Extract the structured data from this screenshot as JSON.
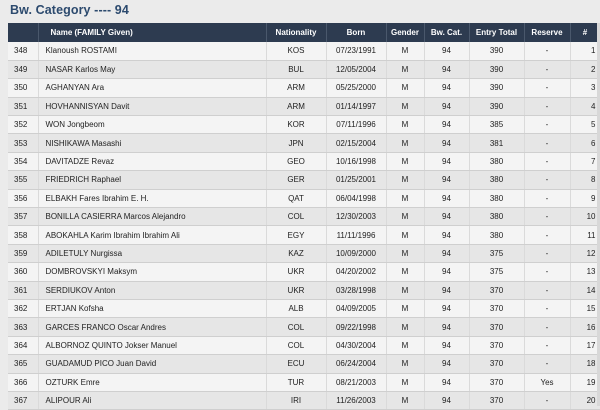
{
  "page": {
    "title": "Bw. Category ---- 94"
  },
  "table": {
    "headers": {
      "num": "",
      "name": "Name (FAMILY Given)",
      "nationality": "Nationality",
      "born": "Born",
      "gender": "Gender",
      "bwcat": "Bw. Cat.",
      "entry": "Entry Total",
      "reserve": "Reserve",
      "rank": "#"
    },
    "rows": [
      {
        "num": "348",
        "name": "Klanoush ROSTAMI",
        "nat": "KOS",
        "born": "07/23/1991",
        "gender": "M",
        "bw": "94",
        "entry": "390",
        "reserve": "-",
        "rank": "1"
      },
      {
        "num": "349",
        "name": "NASAR Karlos May",
        "nat": "BUL",
        "born": "12/05/2004",
        "gender": "M",
        "bw": "94",
        "entry": "390",
        "reserve": "-",
        "rank": "2"
      },
      {
        "num": "350",
        "name": "AGHANYAN Ara",
        "nat": "ARM",
        "born": "05/25/2000",
        "gender": "M",
        "bw": "94",
        "entry": "390",
        "reserve": "-",
        "rank": "3"
      },
      {
        "num": "351",
        "name": "HOVHANNISYAN Davit",
        "nat": "ARM",
        "born": "01/14/1997",
        "gender": "M",
        "bw": "94",
        "entry": "390",
        "reserve": "-",
        "rank": "4"
      },
      {
        "num": "352",
        "name": "WON Jongbeom",
        "nat": "KOR",
        "born": "07/11/1996",
        "gender": "M",
        "bw": "94",
        "entry": "385",
        "reserve": "-",
        "rank": "5"
      },
      {
        "num": "353",
        "name": "NISHIKAWA Masashi",
        "nat": "JPN",
        "born": "02/15/2004",
        "gender": "M",
        "bw": "94",
        "entry": "381",
        "reserve": "-",
        "rank": "6"
      },
      {
        "num": "354",
        "name": "DAVITADZE Revaz",
        "nat": "GEO",
        "born": "10/16/1998",
        "gender": "M",
        "bw": "94",
        "entry": "380",
        "reserve": "-",
        "rank": "7"
      },
      {
        "num": "355",
        "name": "FRIEDRICH Raphael",
        "nat": "GER",
        "born": "01/25/2001",
        "gender": "M",
        "bw": "94",
        "entry": "380",
        "reserve": "-",
        "rank": "8"
      },
      {
        "num": "356",
        "name": "ELBAKH Fares Ibrahim E. H.",
        "nat": "QAT",
        "born": "06/04/1998",
        "gender": "M",
        "bw": "94",
        "entry": "380",
        "reserve": "-",
        "rank": "9"
      },
      {
        "num": "357",
        "name": "BONILLA CASIERRA Marcos Alejandro",
        "nat": "COL",
        "born": "12/30/2003",
        "gender": "M",
        "bw": "94",
        "entry": "380",
        "reserve": "-",
        "rank": "10"
      },
      {
        "num": "358",
        "name": "ABOKAHLA Karim Ibrahim Ibrahim Ali",
        "nat": "EGY",
        "born": "11/11/1996",
        "gender": "M",
        "bw": "94",
        "entry": "380",
        "reserve": "-",
        "rank": "11"
      },
      {
        "num": "359",
        "name": "ADILETULY Nurgissa",
        "nat": "KAZ",
        "born": "10/09/2000",
        "gender": "M",
        "bw": "94",
        "entry": "375",
        "reserve": "-",
        "rank": "12"
      },
      {
        "num": "360",
        "name": "DOMBROVSKYI Maksym",
        "nat": "UKR",
        "born": "04/20/2002",
        "gender": "M",
        "bw": "94",
        "entry": "375",
        "reserve": "-",
        "rank": "13"
      },
      {
        "num": "361",
        "name": "SERDIUKOV Anton",
        "nat": "UKR",
        "born": "03/28/1998",
        "gender": "M",
        "bw": "94",
        "entry": "370",
        "reserve": "-",
        "rank": "14"
      },
      {
        "num": "362",
        "name": "ERTJAN Kofsha",
        "nat": "ALB",
        "born": "04/09/2005",
        "gender": "M",
        "bw": "94",
        "entry": "370",
        "reserve": "-",
        "rank": "15"
      },
      {
        "num": "363",
        "name": "GARCES FRANCO Oscar Andres",
        "nat": "COL",
        "born": "09/22/1998",
        "gender": "M",
        "bw": "94",
        "entry": "370",
        "reserve": "-",
        "rank": "16"
      },
      {
        "num": "364",
        "name": "ALBORNOZ QUINTO Jokser Manuel",
        "nat": "COL",
        "born": "04/30/2004",
        "gender": "M",
        "bw": "94",
        "entry": "370",
        "reserve": "-",
        "rank": "17"
      },
      {
        "num": "365",
        "name": "GUADAMUD PICO Juan David",
        "nat": "ECU",
        "born": "06/24/2004",
        "gender": "M",
        "bw": "94",
        "entry": "370",
        "reserve": "-",
        "rank": "18"
      },
      {
        "num": "366",
        "name": "OZTURK Emre",
        "nat": "TUR",
        "born": "08/21/2003",
        "gender": "M",
        "bw": "94",
        "entry": "370",
        "reserve": "Yes",
        "rank": "19"
      },
      {
        "num": "367",
        "name": "ALIPOUR Ali",
        "nat": "IRI",
        "born": "11/26/2003",
        "gender": "M",
        "bw": "94",
        "entry": "370",
        "reserve": "-",
        "rank": "20"
      }
    ]
  }
}
